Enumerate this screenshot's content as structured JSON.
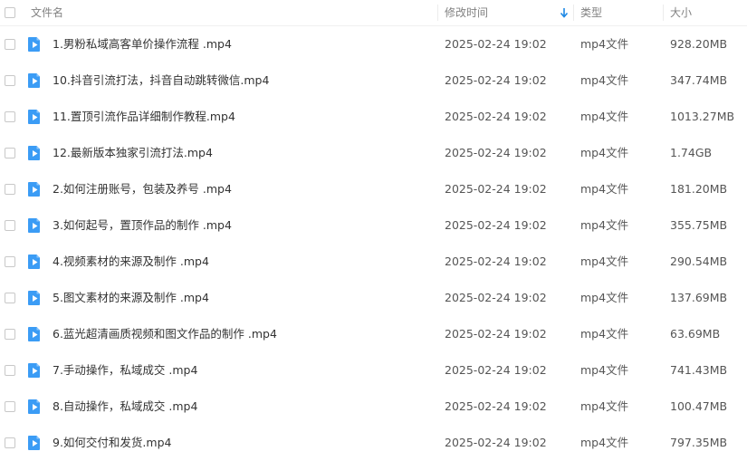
{
  "header": {
    "name_label": "文件名",
    "time_label": "修改时间",
    "type_label": "类型",
    "size_label": "大小",
    "sort_icon": "arrow-down-icon"
  },
  "files": [
    {
      "name": "1.男粉私域高客单价操作流程 .mp4",
      "modified": "2025-02-24 19:02",
      "type": "mp4文件",
      "size": "928.20MB"
    },
    {
      "name": "10.抖音引流打法，抖音自动跳转微信.mp4",
      "modified": "2025-02-24 19:02",
      "type": "mp4文件",
      "size": "347.74MB"
    },
    {
      "name": "11.置顶引流作品详细制作教程.mp4",
      "modified": "2025-02-24 19:02",
      "type": "mp4文件",
      "size": "1013.27MB"
    },
    {
      "name": "12.最新版本独家引流打法.mp4",
      "modified": "2025-02-24 19:02",
      "type": "mp4文件",
      "size": "1.74GB"
    },
    {
      "name": "2.如何注册账号，包装及养号 .mp4",
      "modified": "2025-02-24 19:02",
      "type": "mp4文件",
      "size": "181.20MB"
    },
    {
      "name": "3.如何起号，置顶作品的制作 .mp4",
      "modified": "2025-02-24 19:02",
      "type": "mp4文件",
      "size": "355.75MB"
    },
    {
      "name": "4.视频素材的来源及制作 .mp4",
      "modified": "2025-02-24 19:02",
      "type": "mp4文件",
      "size": "290.54MB"
    },
    {
      "name": "5.图文素材的来源及制作 .mp4",
      "modified": "2025-02-24 19:02",
      "type": "mp4文件",
      "size": "137.69MB"
    },
    {
      "name": "6.蓝光超清画质视频和图文作品的制作 .mp4",
      "modified": "2025-02-24 19:02",
      "type": "mp4文件",
      "size": "63.69MB"
    },
    {
      "name": "7.手动操作，私域成交 .mp4",
      "modified": "2025-02-24 19:02",
      "type": "mp4文件",
      "size": "741.43MB"
    },
    {
      "name": "8.自动操作，私域成交 .mp4",
      "modified": "2025-02-24 19:02",
      "type": "mp4文件",
      "size": "100.47MB"
    },
    {
      "name": "9.如何交付和发货.mp4",
      "modified": "2025-02-24 19:02",
      "type": "mp4文件",
      "size": "797.35MB"
    }
  ],
  "colors": {
    "icon_blue": "#3b9cf5",
    "sort_arrow": "#1e88e5",
    "header_text": "#828282",
    "row_text": "#333333"
  },
  "icons": {
    "file": "video-file-icon",
    "checkbox": "checkbox-icon"
  }
}
